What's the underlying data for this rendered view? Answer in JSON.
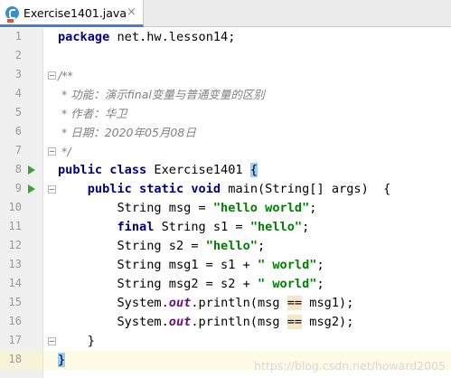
{
  "tab": {
    "label": "Exercise1401.java",
    "close_glyph": "×"
  },
  "lines": [
    {
      "num": "1",
      "tokens": [
        {
          "t": "package",
          "c": "kw"
        },
        {
          "t": " net.hw.lesson14;",
          "c": ""
        }
      ]
    },
    {
      "num": "2",
      "tokens": []
    },
    {
      "num": "3",
      "tokens": [
        {
          "t": "/**",
          "c": "cmt"
        }
      ]
    },
    {
      "num": "4",
      "tokens": [
        {
          "t": " * 功能：演示final变量与普通变量的区别",
          "c": "cmt"
        }
      ]
    },
    {
      "num": "5",
      "tokens": [
        {
          "t": " * 作者：华卫",
          "c": "cmt"
        }
      ]
    },
    {
      "num": "6",
      "tokens": [
        {
          "t": " * 日期：2020年05月08日",
          "c": "cmt"
        }
      ]
    },
    {
      "num": "7",
      "tokens": [
        {
          "t": " */",
          "c": "cmt"
        }
      ]
    },
    {
      "num": "8",
      "tokens": [
        {
          "t": "public class",
          "c": "kw"
        },
        {
          "t": " Exercise1401 ",
          "c": ""
        },
        {
          "t": "{",
          "c": "hl-brace"
        }
      ]
    },
    {
      "num": "9",
      "tokens": [
        {
          "t": "    ",
          "c": ""
        },
        {
          "t": "public static void",
          "c": "kw"
        },
        {
          "t": " main(String[] args)  {",
          "c": ""
        }
      ]
    },
    {
      "num": "10",
      "tokens": [
        {
          "t": "        String msg = ",
          "c": ""
        },
        {
          "t": "\"hello world\"",
          "c": "str"
        },
        {
          "t": ";",
          "c": ""
        }
      ]
    },
    {
      "num": "11",
      "tokens": [
        {
          "t": "        ",
          "c": ""
        },
        {
          "t": "final",
          "c": "kw"
        },
        {
          "t": " String s1 = ",
          "c": ""
        },
        {
          "t": "\"hello\"",
          "c": "str"
        },
        {
          "t": ";",
          "c": ""
        }
      ]
    },
    {
      "num": "12",
      "tokens": [
        {
          "t": "        String s2 = ",
          "c": ""
        },
        {
          "t": "\"hello\"",
          "c": "str"
        },
        {
          "t": ";",
          "c": ""
        }
      ]
    },
    {
      "num": "13",
      "tokens": [
        {
          "t": "        String msg1 = s1 + ",
          "c": ""
        },
        {
          "t": "\" world\"",
          "c": "str"
        },
        {
          "t": ";",
          "c": ""
        }
      ]
    },
    {
      "num": "14",
      "tokens": [
        {
          "t": "        String msg2 = s2 + ",
          "c": ""
        },
        {
          "t": "\" world\"",
          "c": "str"
        },
        {
          "t": ";",
          "c": ""
        }
      ]
    },
    {
      "num": "15",
      "tokens": [
        {
          "t": "        System.",
          "c": ""
        },
        {
          "t": "out",
          "c": "fld"
        },
        {
          "t": ".println(msg ",
          "c": ""
        },
        {
          "t": "==",
          "c": "hl-op"
        },
        {
          "t": " msg1);",
          "c": ""
        }
      ]
    },
    {
      "num": "16",
      "tokens": [
        {
          "t": "        System.",
          "c": ""
        },
        {
          "t": "out",
          "c": "fld"
        },
        {
          "t": ".println(msg ",
          "c": ""
        },
        {
          "t": "==",
          "c": "hl-op"
        },
        {
          "t": " msg2);",
          "c": ""
        }
      ]
    },
    {
      "num": "17",
      "tokens": [
        {
          "t": "    }",
          "c": ""
        }
      ]
    },
    {
      "num": "18",
      "tokens": [
        {
          "t": "}",
          "c": "hl-brace"
        }
      ]
    }
  ],
  "run_markers": [
    "8",
    "9"
  ],
  "fold_markers": [
    "3",
    "7",
    "9",
    "17"
  ],
  "current_line": "18",
  "watermark": "https://blog.csdn.net/howard2005",
  "colors": {
    "keyword": "#000080",
    "string": "#008000",
    "comment": "#808080",
    "field": "#660e7a",
    "run": "#3da03d",
    "brace_highlight": "#99ccff"
  }
}
